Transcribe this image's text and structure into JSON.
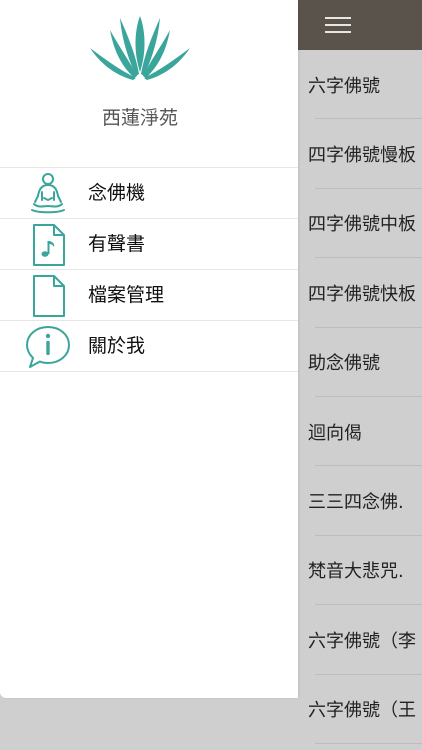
{
  "brand": {
    "name": "西蓮淨苑",
    "accent_color": "#3aa59a"
  },
  "drawer": {
    "items": [
      {
        "label": "念佛機",
        "icon": "meditation-person-icon"
      },
      {
        "label": "有聲書",
        "icon": "music-file-icon"
      },
      {
        "label": "檔案管理",
        "icon": "file-icon"
      },
      {
        "label": "關於我",
        "icon": "info-bubble-icon"
      }
    ]
  },
  "background": {
    "toolbar": {
      "menu_icon": "hamburger-menu-icon"
    },
    "list": [
      "六字佛號",
      "四字佛號慢板",
      "四字佛號中板",
      "四字佛號快板",
      "助念佛號",
      "迴向偈",
      "三三四念佛.",
      "梵音大悲咒.",
      "六字佛號（李",
      "六字佛號（王"
    ]
  }
}
